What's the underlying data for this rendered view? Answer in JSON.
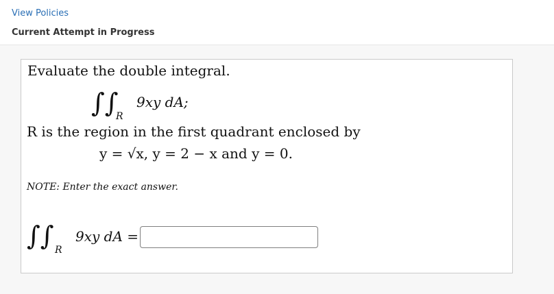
{
  "header": {
    "policies_link": "View Policies",
    "attempt_status": "Current Attempt in Progress"
  },
  "question": {
    "prompt": "Evaluate the double integral.",
    "integrand_display": "9xy dA;",
    "region_subscript": "R",
    "region_sentence": "R is the region in the first quadrant enclosed by",
    "bounds": "y = √x, y = 2 − x and y = 0.",
    "note": "NOTE: Enter the exact answer.",
    "answer_lhs": "9xy dA =",
    "answer_region_subscript": "R",
    "answer_value": ""
  },
  "colors": {
    "link": "#2a6fb5",
    "text": "#111111",
    "box_border": "#c9c9c9",
    "page_background": "#f7f7f7"
  }
}
